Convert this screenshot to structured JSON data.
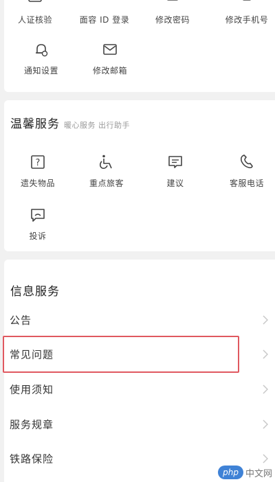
{
  "account_section": {
    "row1": [
      {
        "label": "人证核验",
        "icon": "id-verify-icon"
      },
      {
        "label": "面容 ID 登录",
        "icon": "face-id-icon"
      },
      {
        "label": "修改密码",
        "icon": "password-icon"
      },
      {
        "label": "修改手机号",
        "icon": "phone-edit-icon"
      }
    ],
    "row2": [
      {
        "label": "通知设置",
        "icon": "bell-settings-icon"
      },
      {
        "label": "修改邮箱",
        "icon": "mail-icon"
      }
    ]
  },
  "warm_service": {
    "title": "温馨服务",
    "subtitle": "暖心服务 出行助手",
    "items": [
      {
        "label": "遗失物品",
        "icon": "lost-item-icon"
      },
      {
        "label": "重点旅客",
        "icon": "wheelchair-icon"
      },
      {
        "label": "建议",
        "icon": "suggestion-icon"
      },
      {
        "label": "客服电话",
        "icon": "phone-icon"
      },
      {
        "label": "投诉",
        "icon": "complaint-icon"
      }
    ]
  },
  "info_service": {
    "title": "信息服务",
    "items": [
      {
        "label": "公告"
      },
      {
        "label": "常见问题"
      },
      {
        "label": "使用须知"
      },
      {
        "label": "服务规章"
      },
      {
        "label": "铁路保险"
      }
    ]
  },
  "watermark": {
    "badge": "php",
    "text": "中文网"
  }
}
